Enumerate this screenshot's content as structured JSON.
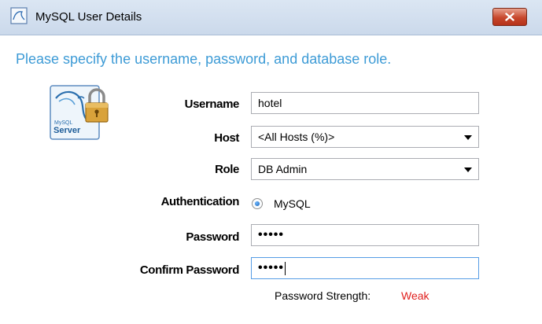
{
  "window": {
    "title": "MySQL User Details",
    "close_icon": "close-icon"
  },
  "instructions": "Please specify the username, password, and database role.",
  "logo": {
    "icon": "mysql-server-lock-icon",
    "text_top": "MySQL",
    "text_bottom": "Server"
  },
  "form": {
    "username": {
      "label": "Username",
      "value": "hotel"
    },
    "host": {
      "label": "Host",
      "selected": "<All Hosts (%)>"
    },
    "role": {
      "label": "Role",
      "selected": "DB Admin"
    },
    "authentication": {
      "label": "Authentication",
      "option": "MySQL",
      "checked": true
    },
    "password": {
      "label": "Password",
      "masked": "•••••"
    },
    "confirm_password": {
      "label": "Confirm Password",
      "masked": "•••••"
    },
    "strength": {
      "label": "Password Strength:",
      "value": "Weak",
      "color": "#e0201e"
    }
  },
  "colors": {
    "instruction_text": "#3d9bd6",
    "close_button": "#c7472c"
  }
}
